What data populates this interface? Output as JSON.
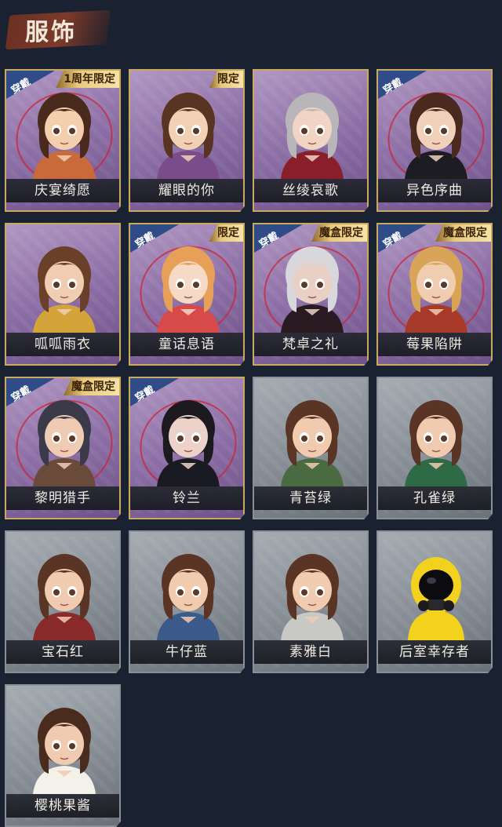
{
  "header": {
    "title": "服饰"
  },
  "cards": [
    {
      "name": "庆宴绮愿",
      "style": "purple",
      "worn": true,
      "tag": "1周年限定",
      "hair": "#4a2a1c",
      "outfit": "#c96a3a",
      "skin": "#f3cfae",
      "ring": true
    },
    {
      "name": "耀眼的你",
      "style": "purple",
      "worn": false,
      "tag": "限定",
      "hair": "#5a3422",
      "outfit": "#7a4c8a",
      "skin": "#f2d0b6",
      "ring": false
    },
    {
      "name": "丝绫哀歌",
      "style": "purple",
      "worn": false,
      "tag": "",
      "hair": "#b8b6b8",
      "outfit": "#8a1f2a",
      "skin": "#f1d4c4",
      "ring": false
    },
    {
      "name": "异色序曲",
      "style": "purple",
      "worn": true,
      "tag": "",
      "hair": "#4a2a1e",
      "outfit": "#1c1c22",
      "skin": "#f0d0b8",
      "ring": true
    },
    {
      "name": "呱呱雨衣",
      "style": "purple",
      "worn": false,
      "tag": "",
      "hair": "#6a4028",
      "outfit": "#d4a43a",
      "skin": "#f0cdb0",
      "ring": false
    },
    {
      "name": "童话息语",
      "style": "purple",
      "worn": true,
      "tag": "限定",
      "hair": "#e8a058",
      "outfit": "#d84a4a",
      "skin": "#f6dac6",
      "ring": true
    },
    {
      "name": "梵卓之礼",
      "style": "purple",
      "worn": true,
      "tag": "魔盒限定",
      "hair": "#d8d8dc",
      "outfit": "#2a1a22",
      "skin": "#ead0c4",
      "ring": true
    },
    {
      "name": "莓果陷阱",
      "style": "purple",
      "worn": true,
      "tag": "魔盒限定",
      "hair": "#d8a458",
      "outfit": "#a83a2a",
      "skin": "#f0cdb0",
      "ring": true
    },
    {
      "name": "黎明猎手",
      "style": "purple",
      "worn": true,
      "tag": "魔盒限定",
      "hair": "#3a3a48",
      "outfit": "#6a4a3a",
      "skin": "#f0cbb4",
      "ring": true
    },
    {
      "name": "铃兰",
      "style": "purple",
      "worn": true,
      "tag": "",
      "hair": "#1c1a1e",
      "outfit": "#1a1a22",
      "skin": "#ecd2c8",
      "ring": true
    },
    {
      "name": "青苔绿",
      "style": "gray",
      "worn": false,
      "tag": "",
      "hair": "#5a3424",
      "outfit": "#4a6a42",
      "skin": "#f0cbb0",
      "ring": false
    },
    {
      "name": "孔雀绿",
      "style": "gray",
      "worn": false,
      "tag": "",
      "hair": "#5a3424",
      "outfit": "#2f6a46",
      "skin": "#f0cbb0",
      "ring": false
    },
    {
      "name": "宝石红",
      "style": "gray",
      "worn": false,
      "tag": "",
      "hair": "#5a3424",
      "outfit": "#8a2a2a",
      "skin": "#f0cbb0",
      "ring": false
    },
    {
      "name": "牛仔蓝",
      "style": "gray",
      "worn": false,
      "tag": "",
      "hair": "#5a3424",
      "outfit": "#3a5a8a",
      "skin": "#f0cbb0",
      "ring": false
    },
    {
      "name": "素雅白",
      "style": "gray",
      "worn": false,
      "tag": "",
      "hair": "#5a3424",
      "outfit": "#c8c8c4",
      "skin": "#f0cbb0",
      "ring": false
    },
    {
      "name": "后室幸存者",
      "style": "gray",
      "worn": false,
      "tag": "",
      "hair": "#f2d21c",
      "outfit": "#f2d21c",
      "skin": "#1a1a1a",
      "ring": false,
      "hazmat": true
    },
    {
      "name": "樱桃果酱",
      "style": "gray",
      "worn": false,
      "tag": "",
      "hair": "#4a2c1e",
      "outfit": "#f4f0ea",
      "skin": "#f0cbb0",
      "ring": false
    },
    {
      "worn_label": "穿戴"
    }
  ]
}
